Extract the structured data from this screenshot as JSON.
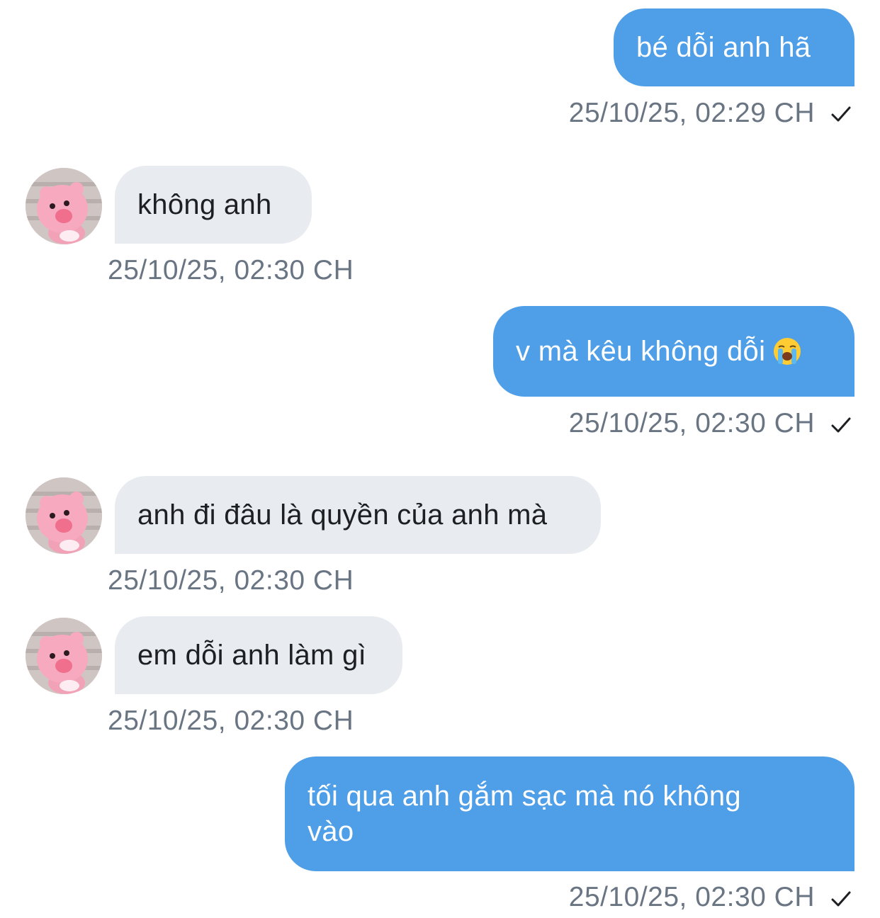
{
  "messages": [
    {
      "dir": "out",
      "text": "bé dỗi anh hã",
      "time": "25/10/25, 02:29 CH",
      "read_icon": "check-icon"
    },
    {
      "dir": "in",
      "text": "không anh",
      "time": "25/10/25, 02:30 CH",
      "avatar": "pink-bear-avatar"
    },
    {
      "dir": "out",
      "text": "v mà kêu không dỗi",
      "emoji": "loudly-crying-face-icon",
      "time": "25/10/25, 02:30 CH",
      "read_icon": "check-icon"
    },
    {
      "dir": "in",
      "text": "anh đi đâu là quyền của anh mà",
      "time": "25/10/25, 02:30 CH",
      "avatar": "pink-bear-avatar"
    },
    {
      "dir": "in",
      "text": "em dỗi anh làm gì",
      "time": "25/10/25, 02:30 CH",
      "avatar": "pink-bear-avatar"
    },
    {
      "dir": "out",
      "text": "tối qua anh gắm sạc mà nó không vào",
      "time": "25/10/25, 02:30 CH",
      "read_icon": "check-icon"
    }
  ],
  "colors": {
    "outgoing_bubble": "#4f9ee8",
    "incoming_bubble": "#e8ebef",
    "timestamp": "#6a7583",
    "background": "#ffffff"
  }
}
